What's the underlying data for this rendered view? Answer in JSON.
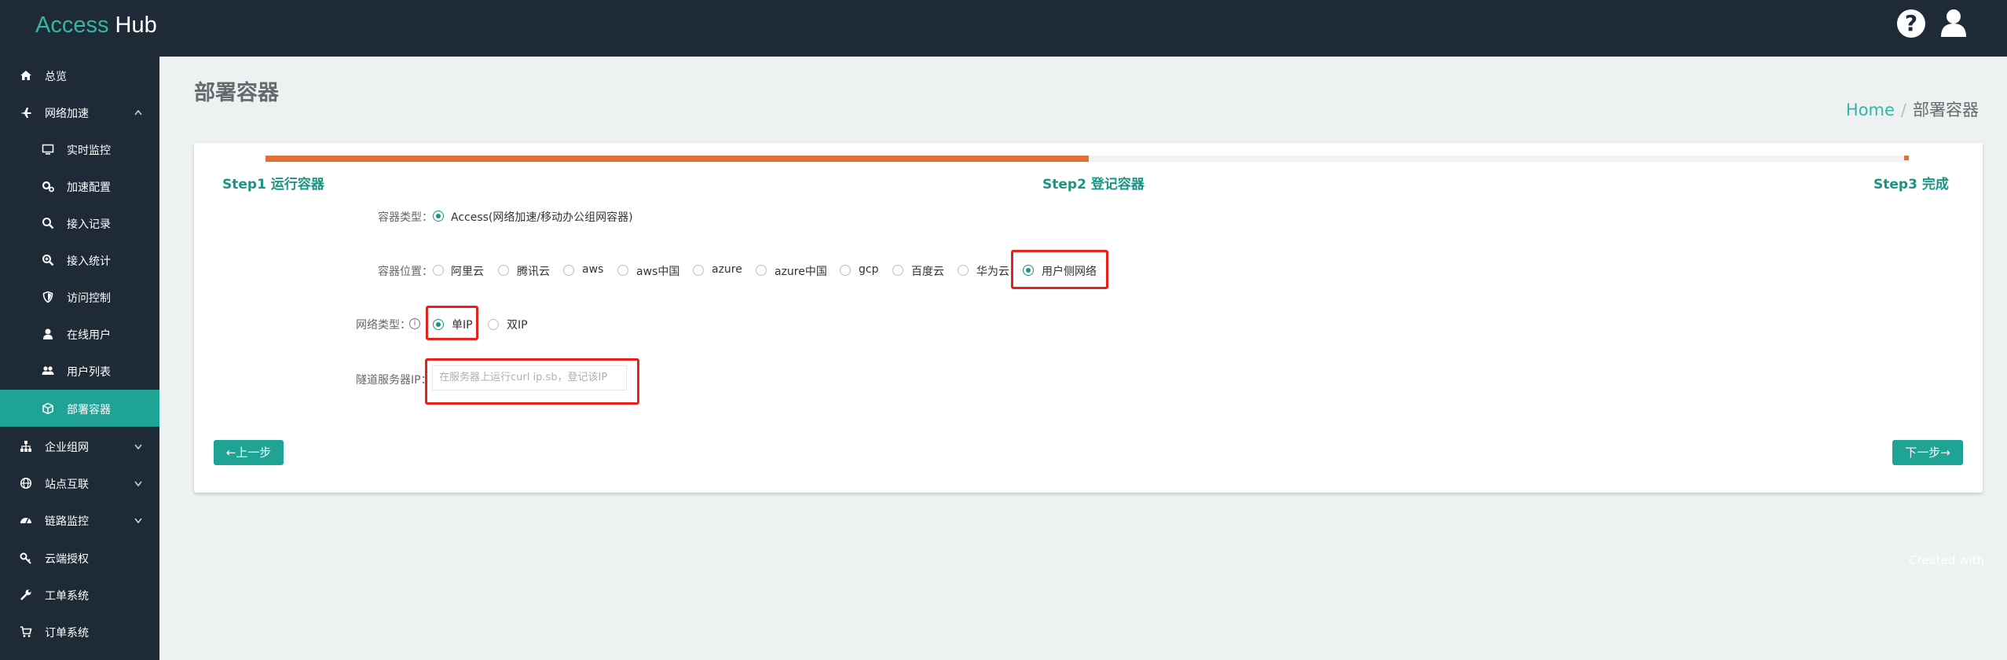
{
  "header": {
    "brand_accent": "Access",
    "brand_rest": " Hub",
    "help_icon": "question-circle-icon",
    "user_icon": "user-icon"
  },
  "sidebar": {
    "items": [
      {
        "label": "总览",
        "icon": "home-icon"
      },
      {
        "label": "网络加速",
        "icon": "plane-icon",
        "caret": "⌃"
      },
      {
        "label": "实时监控",
        "icon": "monitor-icon"
      },
      {
        "label": "加速配置",
        "icon": "gears-icon"
      },
      {
        "label": "接入记录",
        "icon": "search-icon"
      },
      {
        "label": "接入统计",
        "icon": "zoom-icon"
      },
      {
        "label": "访问控制",
        "icon": "shield-icon"
      },
      {
        "label": "在线用户",
        "icon": "user-icon"
      },
      {
        "label": "用户列表",
        "icon": "users-icon"
      },
      {
        "label": "部署容器",
        "icon": "cube-icon",
        "active": true
      },
      {
        "label": "企业组网",
        "icon": "sitemap-icon",
        "caret": "⌄"
      },
      {
        "label": "站点互联",
        "icon": "globe-icon",
        "caret": "⌄"
      },
      {
        "label": "链路监控",
        "icon": "dashboard-icon",
        "caret": "⌄"
      },
      {
        "label": "云端授权",
        "icon": "key-icon"
      },
      {
        "label": "工单系统",
        "icon": "wrench-icon"
      },
      {
        "label": "订单系统",
        "icon": "cart-icon"
      }
    ]
  },
  "page": {
    "title": "部署容器"
  },
  "breadcrumb": {
    "home": "Home",
    "separator": "/",
    "current": "部署容器"
  },
  "wizard": {
    "progress_percent": 50,
    "steps": [
      "Step1 运行容器",
      "Step2 登记容器",
      "Step3 完成"
    ]
  },
  "form": {
    "container_type": {
      "label": "容器类型：",
      "option": "Access(网络加速/移动办公组网容器)",
      "selected": true
    },
    "container_location": {
      "label": "容器位置：",
      "options": [
        "阿里云",
        "腾讯云",
        "aws",
        "aws中国",
        "azure",
        "azure中国",
        "gcp",
        "百度云",
        "华为云",
        "用户侧网络"
      ],
      "selected": "用户侧网络"
    },
    "network_type": {
      "label": "网络类型：",
      "options": [
        "单IP",
        "双IP"
      ],
      "selected": "单IP"
    },
    "tunnel_ip": {
      "label": "隧道服务器IP：",
      "placeholder": "在服务器上运行curl ip.sb，登记该IP"
    }
  },
  "buttons": {
    "prev": "←上一步",
    "next": "下一步→"
  },
  "watermark": "Created with",
  "colors": {
    "accent": "#1fa394",
    "progress": "#e07038",
    "highlight": "#e8211d",
    "header_bg": "#1e2a35"
  }
}
